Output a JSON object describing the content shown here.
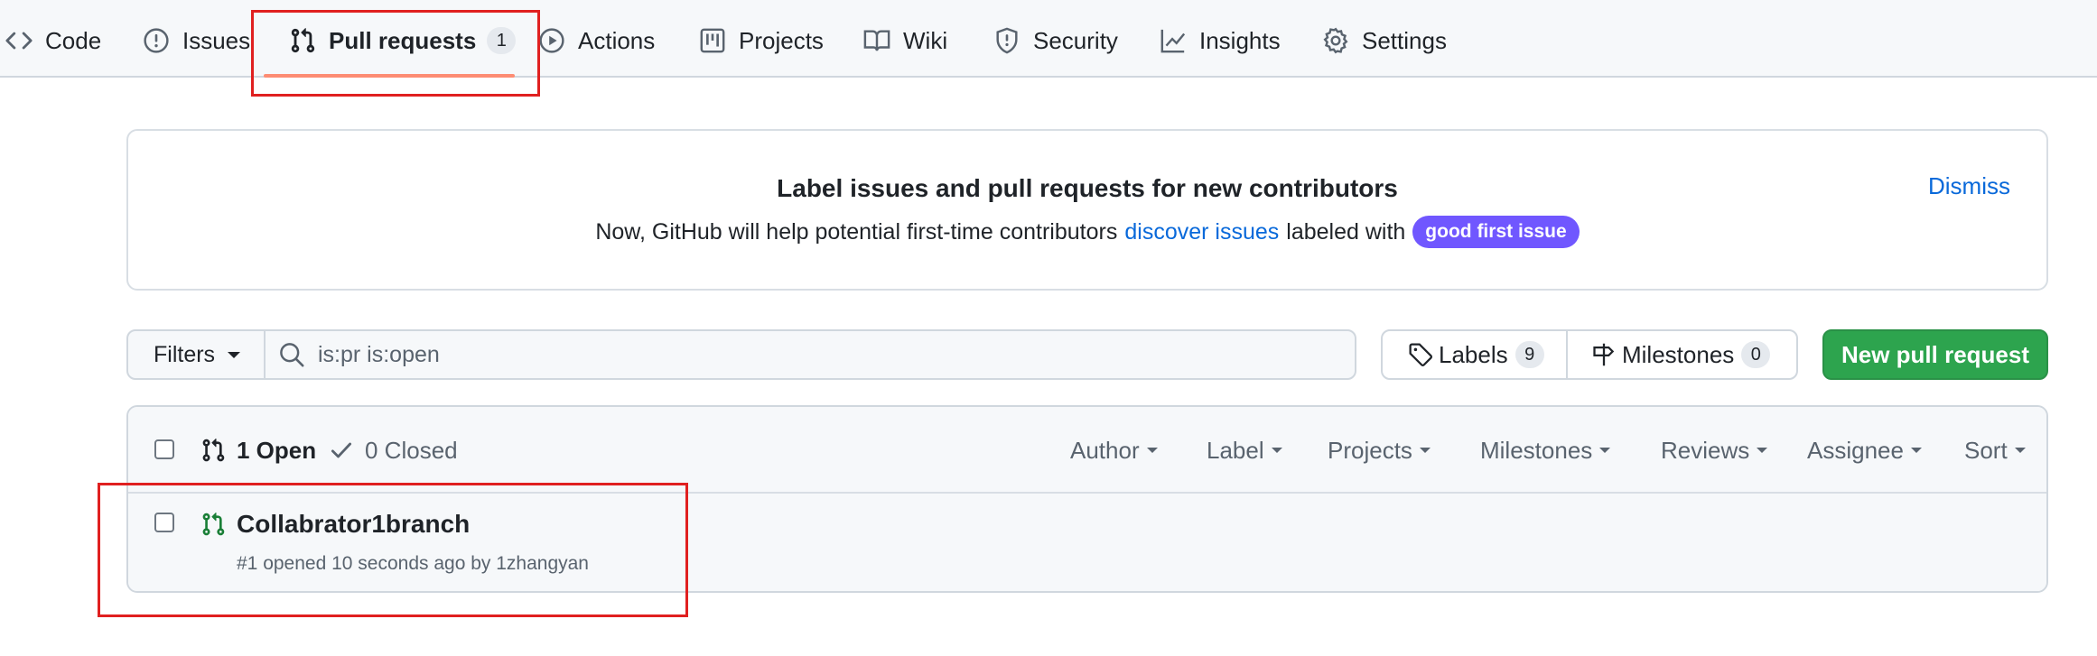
{
  "nav": {
    "items": [
      {
        "label": "Code",
        "icon": "code-icon"
      },
      {
        "label": "Issues",
        "icon": "issue-opened-icon"
      },
      {
        "label": "Pull requests",
        "icon": "git-pull-request-icon",
        "count": "1",
        "active": true
      },
      {
        "label": "Actions",
        "icon": "play-icon"
      },
      {
        "label": "Projects",
        "icon": "table-icon"
      },
      {
        "label": "Wiki",
        "icon": "book-icon"
      },
      {
        "label": "Security",
        "icon": "shield-icon"
      },
      {
        "label": "Insights",
        "icon": "graph-icon"
      },
      {
        "label": "Settings",
        "icon": "gear-icon"
      }
    ],
    "active_underline_color": "#fd8c73"
  },
  "banner": {
    "title": "Label issues and pull requests for new contributors",
    "text_before": "Now, GitHub will help potential first-time contributors",
    "link_text": "discover issues",
    "text_after": "labeled with",
    "label_pill": "good first issue",
    "label_color": "#7057ff",
    "dismiss": "Dismiss"
  },
  "filter_bar": {
    "filters_label": "Filters",
    "search_value": "is:pr is:open",
    "labels_label": "Labels",
    "labels_count": "9",
    "milestones_label": "Milestones",
    "milestones_count": "0",
    "new_pr_label": "New pull request",
    "new_pr_color": "#2da44e"
  },
  "list": {
    "open_label": "1 Open",
    "closed_label": "0 Closed",
    "header_filters": [
      "Author",
      "Label",
      "Projects",
      "Milestones",
      "Reviews",
      "Assignee",
      "Sort"
    ],
    "rows": [
      {
        "title": "Collabrator1branch",
        "meta": "#1 opened 10 seconds ago by 1zhangyan",
        "icon": "git-pull-request-open-icon",
        "icon_color": "#1a7f37"
      }
    ]
  },
  "annotations": {
    "highlight_color": "#e02020"
  }
}
